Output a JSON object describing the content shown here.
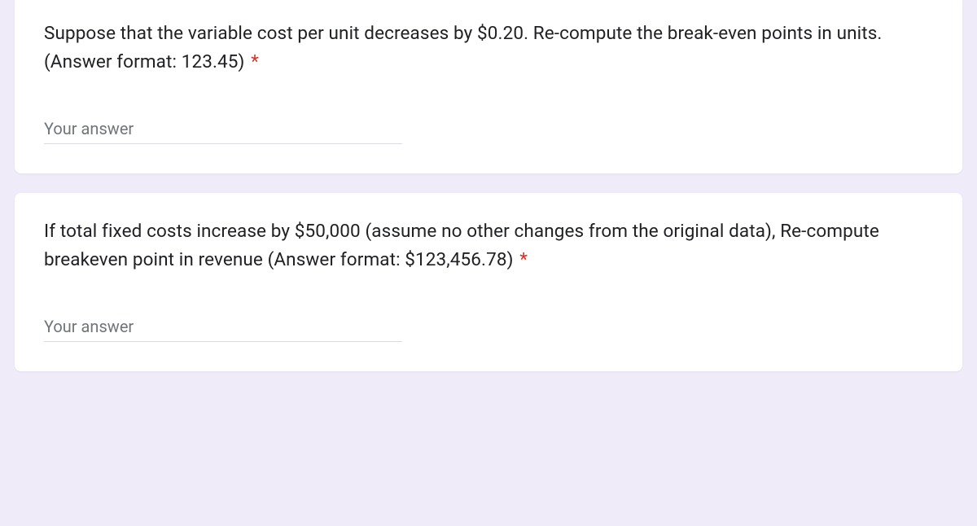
{
  "questions": [
    {
      "text": "Suppose that the variable cost per unit decreases by $0.20. Re-compute the break-even points in units. (Answer format: 123.45)",
      "required_marker": "*",
      "answer_placeholder": "Your answer",
      "answer_value": ""
    },
    {
      "text": "If total fixed costs increase by $50,000 (assume no other changes from the original data), Re-compute breakeven point in revenue (Answer format: $123,456.78)",
      "required_marker": "*",
      "answer_placeholder": "Your answer",
      "answer_value": ""
    }
  ]
}
